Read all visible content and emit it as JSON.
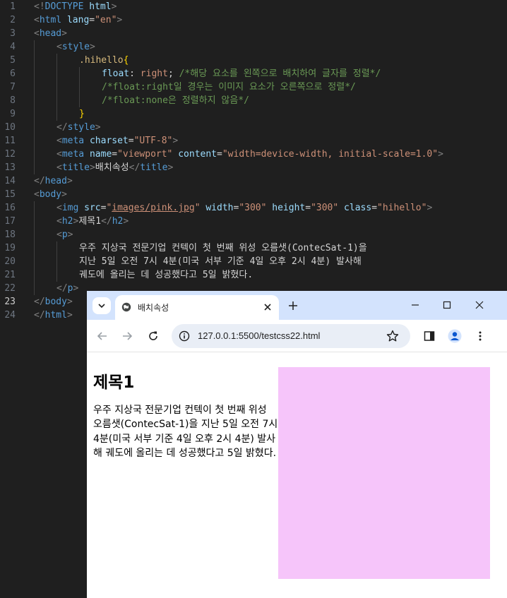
{
  "editor": {
    "active_line": 23,
    "lines": [
      {
        "n": "1",
        "tokens": [
          [
            "t-br",
            "<!"
          ],
          [
            "t-tag",
            "DOCTYPE"
          ],
          [
            "t-txt",
            " "
          ],
          [
            "t-attr",
            "html"
          ],
          [
            "t-br",
            ">"
          ]
        ]
      },
      {
        "n": "2",
        "tokens": [
          [
            "t-br",
            "<"
          ],
          [
            "t-tag",
            "html"
          ],
          [
            "t-txt",
            " "
          ],
          [
            "t-attr",
            "lang"
          ],
          [
            "t-txt",
            "="
          ],
          [
            "t-str",
            "\"en\""
          ],
          [
            "t-br",
            ">"
          ]
        ]
      },
      {
        "n": "3",
        "tokens": [
          [
            "t-br",
            "<"
          ],
          [
            "t-tag",
            "head"
          ],
          [
            "t-br",
            ">"
          ]
        ]
      },
      {
        "n": "4",
        "indent": 1,
        "tokens": [
          [
            "t-br",
            "<"
          ],
          [
            "t-tag",
            "style"
          ],
          [
            "t-br",
            ">"
          ]
        ]
      },
      {
        "n": "5",
        "indent": 2,
        "tokens": [
          [
            "t-sel",
            ".hihello"
          ],
          [
            "t-brace",
            "{"
          ]
        ]
      },
      {
        "n": "6",
        "indent": 3,
        "tokens": [
          [
            "t-prop",
            "float"
          ],
          [
            "t-txt",
            ": "
          ],
          [
            "t-val",
            "right"
          ],
          [
            "t-txt",
            "; "
          ],
          [
            "t-cmt",
            "/*해당 요소를 왼쪽으로 배치하여 글자를 정렬*/"
          ]
        ]
      },
      {
        "n": "7",
        "indent": 3,
        "tokens": [
          [
            "t-cmt",
            "/*float:right일 경우는 이미지 요소가 오른쪽으로 정렬*/"
          ]
        ]
      },
      {
        "n": "8",
        "indent": 3,
        "tokens": [
          [
            "t-cmt",
            "/*float:none은 정렬하지 않음*/"
          ]
        ]
      },
      {
        "n": "9",
        "indent": 2,
        "tokens": [
          [
            "t-brace",
            "}"
          ]
        ]
      },
      {
        "n": "10",
        "indent": 1,
        "tokens": [
          [
            "t-br",
            "</"
          ],
          [
            "t-tag",
            "style"
          ],
          [
            "t-br",
            ">"
          ]
        ]
      },
      {
        "n": "11",
        "indent": 1,
        "tokens": [
          [
            "t-br",
            "<"
          ],
          [
            "t-tag",
            "meta"
          ],
          [
            "t-txt",
            " "
          ],
          [
            "t-attr",
            "charset"
          ],
          [
            "t-txt",
            "="
          ],
          [
            "t-str",
            "\"UTF-8\""
          ],
          [
            "t-br",
            ">"
          ]
        ]
      },
      {
        "n": "12",
        "indent": 1,
        "tokens": [
          [
            "t-br",
            "<"
          ],
          [
            "t-tag",
            "meta"
          ],
          [
            "t-txt",
            " "
          ],
          [
            "t-attr",
            "name"
          ],
          [
            "t-txt",
            "="
          ],
          [
            "t-str",
            "\"viewport\""
          ],
          [
            "t-txt",
            " "
          ],
          [
            "t-attr",
            "content"
          ],
          [
            "t-txt",
            "="
          ],
          [
            "t-str",
            "\"width=device-width, initial-scale=1.0\""
          ],
          [
            "t-br",
            ">"
          ]
        ]
      },
      {
        "n": "13",
        "indent": 1,
        "tokens": [
          [
            "t-br",
            "<"
          ],
          [
            "t-tag",
            "title"
          ],
          [
            "t-br",
            ">"
          ],
          [
            "t-txt",
            "배치속성"
          ],
          [
            "t-br",
            "</"
          ],
          [
            "t-tag",
            "title"
          ],
          [
            "t-br",
            ">"
          ]
        ]
      },
      {
        "n": "14",
        "tokens": [
          [
            "t-br",
            "</"
          ],
          [
            "t-tag",
            "head"
          ],
          [
            "t-br",
            ">"
          ]
        ]
      },
      {
        "n": "15",
        "tokens": [
          [
            "t-br",
            "<"
          ],
          [
            "t-tag",
            "body"
          ],
          [
            "t-br",
            ">"
          ]
        ]
      },
      {
        "n": "16",
        "indent": 1,
        "tokens": [
          [
            "t-br",
            "<"
          ],
          [
            "t-tag",
            "img"
          ],
          [
            "t-txt",
            " "
          ],
          [
            "t-attr",
            "src"
          ],
          [
            "t-txt",
            "="
          ],
          [
            "t-str",
            "\""
          ],
          [
            "t-link",
            "images/pink.jpg"
          ],
          [
            "t-str",
            "\""
          ],
          [
            "t-txt",
            " "
          ],
          [
            "t-attr",
            "width"
          ],
          [
            "t-txt",
            "="
          ],
          [
            "t-str",
            "\"300\""
          ],
          [
            "t-txt",
            " "
          ],
          [
            "t-attr",
            "height"
          ],
          [
            "t-txt",
            "="
          ],
          [
            "t-str",
            "\"300\""
          ],
          [
            "t-txt",
            " "
          ],
          [
            "t-attr",
            "class"
          ],
          [
            "t-txt",
            "="
          ],
          [
            "t-str",
            "\"hihello\""
          ],
          [
            "t-br",
            ">"
          ]
        ]
      },
      {
        "n": "17",
        "indent": 1,
        "tokens": [
          [
            "t-br",
            "<"
          ],
          [
            "t-tag",
            "h2"
          ],
          [
            "t-br",
            ">"
          ],
          [
            "t-txt",
            "제목1"
          ],
          [
            "t-br",
            "</"
          ],
          [
            "t-tag",
            "h2"
          ],
          [
            "t-br",
            ">"
          ]
        ]
      },
      {
        "n": "18",
        "indent": 1,
        "tokens": [
          [
            "t-br",
            "<"
          ],
          [
            "t-tag",
            "p"
          ],
          [
            "t-br",
            ">"
          ]
        ]
      },
      {
        "n": "19",
        "indent": 2,
        "tokens": [
          [
            "t-txt",
            "우주 지상국 전문기업 컨텍이 첫 번째 위성 오름샛(ContecSat-1)을"
          ]
        ]
      },
      {
        "n": "20",
        "indent": 2,
        "tokens": [
          [
            "t-txt",
            "지난 5일 오전 7시 4분(미국 서부 기준 4일 오후 2시 4분) 발사해"
          ]
        ]
      },
      {
        "n": "21",
        "indent": 2,
        "tokens": [
          [
            "t-txt",
            "궤도에 올리는 데 성공했다고 5일 밝혔다."
          ]
        ]
      },
      {
        "n": "22",
        "indent": 1,
        "tokens": [
          [
            "t-br",
            "</"
          ],
          [
            "t-tag",
            "p"
          ],
          [
            "t-br",
            ">"
          ]
        ]
      },
      {
        "n": "23",
        "tokens": [
          [
            "t-br",
            "</"
          ],
          [
            "t-tag",
            "body"
          ],
          [
            "t-br",
            ">"
          ]
        ]
      },
      {
        "n": "24",
        "tokens": [
          [
            "t-br",
            "</"
          ],
          [
            "t-tag",
            "html"
          ],
          [
            "t-br",
            ">"
          ]
        ]
      }
    ]
  },
  "browser": {
    "tab_title": "배치속성",
    "url": "127.0.0.1:5500/testcss22.html",
    "page": {
      "heading": "제목1",
      "paragraph": "우주 지상국 전문기업 컨텍이 첫 번째 위성 오름샛(ContecSat-1)을 지난 5일 오전 7시 4분(미국 서부 기준 4일 오후 2시 4분) 발사해 궤도에 올리는 데 성공했다고 5일 밝혔다.",
      "image_color": "#f6c5fa"
    },
    "icons": {
      "tab_search": "chevron-down-icon",
      "favicon": "globe-icon",
      "tab_close": "close-icon",
      "new_tab": "plus-icon",
      "minimize": "minimize-icon",
      "maximize": "maximize-icon",
      "close_window": "close-icon",
      "back": "arrow-left-icon",
      "forward": "arrow-right-icon",
      "reload": "reload-icon",
      "site_info": "info-icon",
      "bookmark": "star-icon",
      "side_panel": "side-panel-icon",
      "profile": "profile-icon",
      "menu": "more-vert-icon"
    }
  }
}
